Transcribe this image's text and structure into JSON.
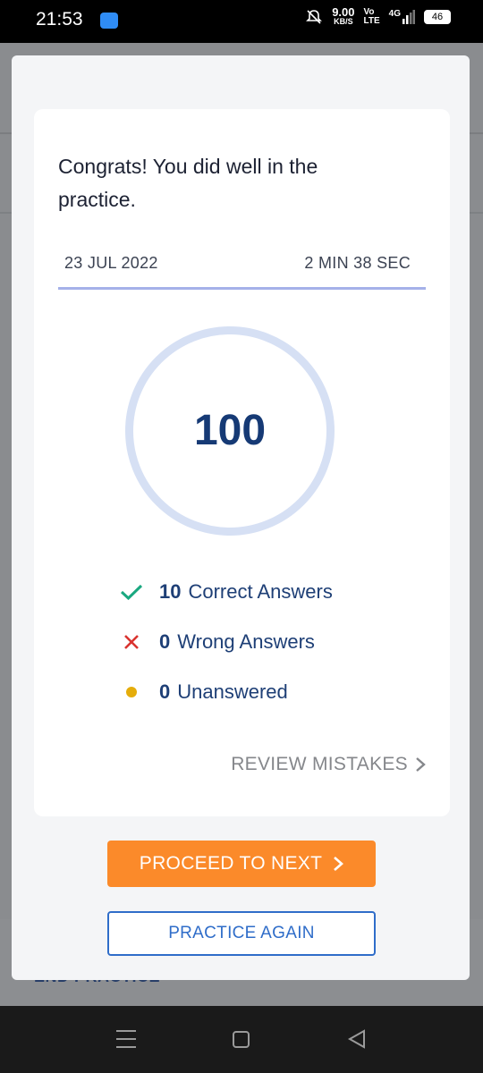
{
  "status_bar": {
    "time": "21:53",
    "speed_value": "9.00",
    "speed_unit": "KB/S",
    "network_top": "Vo",
    "network_bottom": "LTE",
    "signal_label": "4G",
    "battery": "46"
  },
  "background": {
    "end_practice_label": "END PRACTICE"
  },
  "result": {
    "message": "Congrats! You did well in the practice.",
    "date": "23 JUL 2022",
    "duration": "2 MIN 38 SEC",
    "score": "100",
    "correct_count": "10",
    "correct_label": "Correct Answers",
    "wrong_count": "0",
    "wrong_label": "Wrong Answers",
    "unanswered_count": "0",
    "unanswered_label": "Unanswered",
    "review_label": "REVIEW MISTAKES"
  },
  "actions": {
    "proceed_label": "PROCEED TO NEXT",
    "practice_again_label": "PRACTICE AGAIN"
  },
  "colors": {
    "accent_orange": "#fb8a2a",
    "accent_blue": "#2f6dc9",
    "correct_green": "#1aa880",
    "wrong_red": "#d9332f",
    "unanswered_yellow": "#e5ad0b"
  },
  "icons": {
    "correct": "check-icon",
    "wrong": "x-icon",
    "unanswered": "dot-icon",
    "review": "chevron-right-icon",
    "proceed": "chevron-right-icon"
  }
}
